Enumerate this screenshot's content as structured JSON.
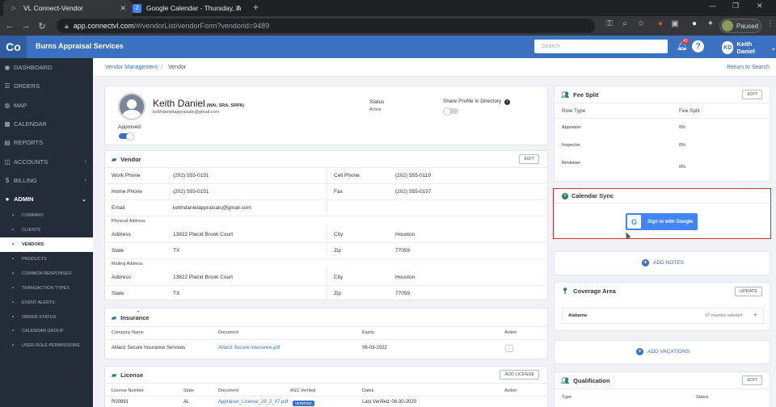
{
  "browser": {
    "tabs": [
      {
        "title": "VL Connect-Vendor",
        "icon": "vl-favicon-icon"
      },
      {
        "title": "Google Calendar - Thursday, July",
        "icon": "google-calendar-favicon-icon",
        "badge": "2"
      }
    ],
    "new_tab_symbol": "+",
    "url_host": "app.connectvl.com",
    "url_path": "/#/vendorList/vendorForm?vendorid=9489",
    "profile_status": "Paused"
  },
  "app": {
    "logo": "Co",
    "company": "Burns Appraisal Services",
    "search_placeholder": "Search",
    "notification_count": "43",
    "help_symbol": "?",
    "user_initials": "KD",
    "user_name": "Keith Daniel"
  },
  "sidebar": {
    "items": [
      {
        "label": "DASHBOARD",
        "icon": "dashboard-icon",
        "glyph": "◉"
      },
      {
        "label": "ORDERS",
        "icon": "orders-icon",
        "glyph": "☰"
      },
      {
        "label": "MAP",
        "icon": "map-icon",
        "glyph": "◍"
      },
      {
        "label": "CALENDAR",
        "icon": "calendar-icon",
        "glyph": "▦"
      },
      {
        "label": "REPORTS",
        "icon": "reports-icon",
        "glyph": "▤"
      },
      {
        "label": "ACCOUNTS",
        "icon": "accounts-icon",
        "glyph": "◫",
        "chevron": "›"
      },
      {
        "label": "BILLING",
        "icon": "billing-icon",
        "glyph": "$",
        "chevron": "›"
      },
      {
        "label": "ADMIN",
        "icon": "admin-icon",
        "glyph": "●",
        "chevron": "⌄"
      }
    ],
    "admin_items": [
      {
        "label": "COMPANY",
        "icon": "company-icon"
      },
      {
        "label": "CLIENTS",
        "icon": "clients-icon"
      },
      {
        "label": "VENDORS",
        "icon": "vendors-icon"
      },
      {
        "label": "PRODUCTS",
        "icon": "products-icon"
      },
      {
        "label": "COMMON RESPONSES",
        "icon": "common-responses-icon"
      },
      {
        "label": "TRANSACTION TYPES",
        "icon": "transaction-types-icon"
      },
      {
        "label": "EVENT ALERTS",
        "icon": "event-alerts-icon"
      },
      {
        "label": "ORDER STATUS",
        "icon": "order-status-icon"
      },
      {
        "label": "CALENDAR GROUP",
        "icon": "calendar-group-icon"
      },
      {
        "label": "USER ROLE PERMISSIONS",
        "icon": "user-role-permissions-icon"
      }
    ],
    "active_admin_index": 2
  },
  "breadcrumb": {
    "parent": "Vendor Management",
    "separator": "/",
    "current": "Vendor",
    "return_link": "Return to Search"
  },
  "profile": {
    "name": "Keith Daniel",
    "designations": "(MAI, SRA, SRPA)",
    "email": "keithdanielappraisals@gmail.com",
    "approved_label": "Approved",
    "approved_on": true,
    "status_label": "Status",
    "status_value": "Active",
    "share_label": "Share Profile in Directory",
    "share_on": false
  },
  "vendor": {
    "title": "Vendor",
    "edit_label": "EDIT",
    "work_phone": {
      "label": "Work Phone",
      "value": "(202) 555-0151"
    },
    "cell_phone": {
      "label": "Cell Phone",
      "value": "(202) 555-0119"
    },
    "home_phone": {
      "label": "Home Phone",
      "value": "(202) 555-0151"
    },
    "fax": {
      "label": "Fax",
      "value": "(202) 555-0157"
    },
    "email": {
      "label": "Email",
      "value": "keithdanielappraisals@gmail.com"
    },
    "physical_address_label": "Physical Address",
    "physical": {
      "address": {
        "label": "Address",
        "value": "13822 Placid Brook Court"
      },
      "city": {
        "label": "City",
        "value": "Houston"
      },
      "state": {
        "label": "State",
        "value": "TX"
      },
      "zip": {
        "label": "Zip",
        "value": "77059"
      }
    },
    "mailing_address_label": "Mailing Address",
    "mailing": {
      "address": {
        "label": "Address",
        "value": "13822 Placid Brook Court"
      },
      "city": {
        "label": "City",
        "value": "Houston"
      },
      "state": {
        "label": "State",
        "value": "TX"
      },
      "zip": {
        "label": "Zip",
        "value": "77059"
      }
    }
  },
  "insurance": {
    "title": "Insurance",
    "headers": [
      "Company Name",
      "Document",
      "Expiry",
      "Action"
    ],
    "rows": [
      {
        "company": "Allianz Secure Insurance Services",
        "document": "Allianz Secure Insurance.pdf",
        "expiry": "06-03-2022",
        "action": "⌄"
      }
    ]
  },
  "license": {
    "title": "License",
    "add_label": "ADD LICENSE",
    "headers": [
      "License Number",
      "State",
      "Document",
      "ASC Verified",
      "Dates",
      "Action"
    ],
    "rows": [
      {
        "number": "R00891",
        "state": "AL",
        "document": "Appraiser_License_26_2_07.pdf",
        "asc": "VERIFIED",
        "dates": "Last Verified: 06-30-2020"
      }
    ]
  },
  "fee_split": {
    "title": "Fee Split",
    "edit_label": "EDIT",
    "headers": [
      "Role Type",
      "Fee Split"
    ],
    "rows": [
      {
        "role": "Appraiser",
        "fee": "0%"
      },
      {
        "role": "Inspector",
        "fee": "0%"
      },
      {
        "role": "Reviewer",
        "fee": "0%"
      }
    ]
  },
  "calendar_sync": {
    "title": "Calendar Sync",
    "button_label": "Sign in with Google",
    "google_glyph": "G",
    "highlight_color": "#d32f2f"
  },
  "notes": {
    "label": "ADD NOTES"
  },
  "coverage": {
    "title": "Coverage Area",
    "update_label": "UPDATE",
    "state": "Alabama",
    "summary": "67 counties selected",
    "expand_symbol": "+"
  },
  "vacations": {
    "label": "ADD VACATIONS"
  },
  "qualification": {
    "title": "Qualification",
    "edit_label": "EDIT",
    "headers": [
      "Type",
      "Status"
    ]
  },
  "colors": {
    "primary": "#3b71c1",
    "sidebar": "#242c3a",
    "accent": "#2e7d6f"
  }
}
